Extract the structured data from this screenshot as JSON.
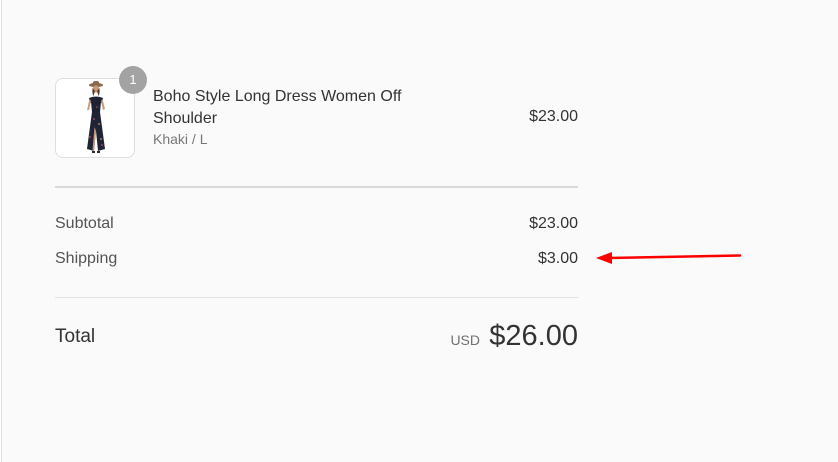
{
  "order_summary": {
    "product": {
      "name": "Boho Style Long Dress Women Off Shoulder",
      "variant": "Khaki / L",
      "price": "$23.00",
      "quantity": "1"
    },
    "subtotal_label": "Subtotal",
    "subtotal_value": "$23.00",
    "shipping_label": "Shipping",
    "shipping_value": "$3.00",
    "total_label": "Total",
    "currency": "USD",
    "total_value": "$26.00"
  },
  "annotation": {
    "arrow_color": "#ff0000"
  }
}
